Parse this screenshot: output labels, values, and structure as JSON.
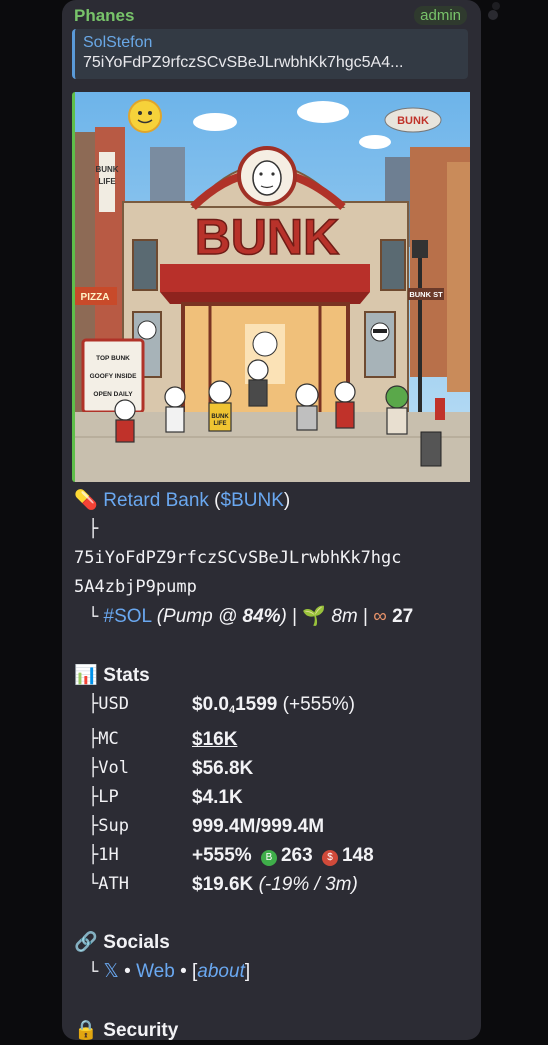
{
  "message": {
    "sender": "Phanes",
    "role": "admin",
    "reply": {
      "name": "SolStefon",
      "text": "75iYoFdPZ9rfczSCvSBeJLrwbhKk7hgc5A4..."
    },
    "image": {
      "sign_text": "BUNK",
      "blimp_text": "BUNK",
      "street_sign": "BUNK ST",
      "shop_tag": "PIZZA",
      "side_tower": [
        "BUNK",
        "LIFE"
      ],
      "menu_board": [
        "TOP BUNK",
        "GOOFY INSIDE",
        "OPEN DAILY"
      ],
      "shirt_text": [
        "BUNK",
        "LIFE"
      ]
    },
    "token": {
      "icon": "pill-icon",
      "name": "Retard Bank",
      "symbol_open": " (",
      "symbol": "$BUNK",
      "symbol_close": ")",
      "tree_branch": "├",
      "address_line1": "75iYoFdPZ9rfczSCvSBeJLrwbhKk7hgc",
      "address_line2": "5A4zbjP9pump",
      "tree_end": "└",
      "chain": "#SOL",
      "pump_prefix": "(Pump @ ",
      "pump_pct": "84%",
      "pump_suffix": ")",
      "sep": " | ",
      "age_icon": "seedling-icon",
      "age": "8m",
      "holders_icon": "eyes-icon",
      "holders": "27"
    },
    "stats": {
      "icon": "bar-chart-icon",
      "title": "Stats",
      "usd_key": "├USD",
      "usd_a": "$0.0",
      "usd_sub": "4",
      "usd_b": "1599",
      "usd_change": " (+555%)",
      "mc_key": "├MC",
      "mc": "$16K",
      "vol_key": "├Vol",
      "vol": "$56.8K",
      "lp_key": "├LP",
      "lp": "$4.1K",
      "sup_key": "├Sup",
      "sup": "999.4M/999.4M",
      "h1_key": "├1H",
      "h1_change": "+555%",
      "buys_badge": "B",
      "buys": "263",
      "sells_badge": "$",
      "sells": "148",
      "ath_key": "└ATH",
      "ath": "$19.6K",
      "ath_detail": "(-19% / 3m)"
    },
    "socials": {
      "icon": "link-icon",
      "title": "Socials",
      "tree_end": "└",
      "x": "𝕏",
      "dot": " • ",
      "web": "Web",
      "about_open": "[",
      "about": "about",
      "about_close": "]"
    },
    "security": {
      "icon": "lock-icon",
      "title": "Security"
    }
  },
  "colors": {
    "bubble": "#2c2c34",
    "sender": "#78c36a",
    "link": "#6aa8f0",
    "reply_bar": "#5a9ad8",
    "media_bar": "#5fbf4a"
  }
}
